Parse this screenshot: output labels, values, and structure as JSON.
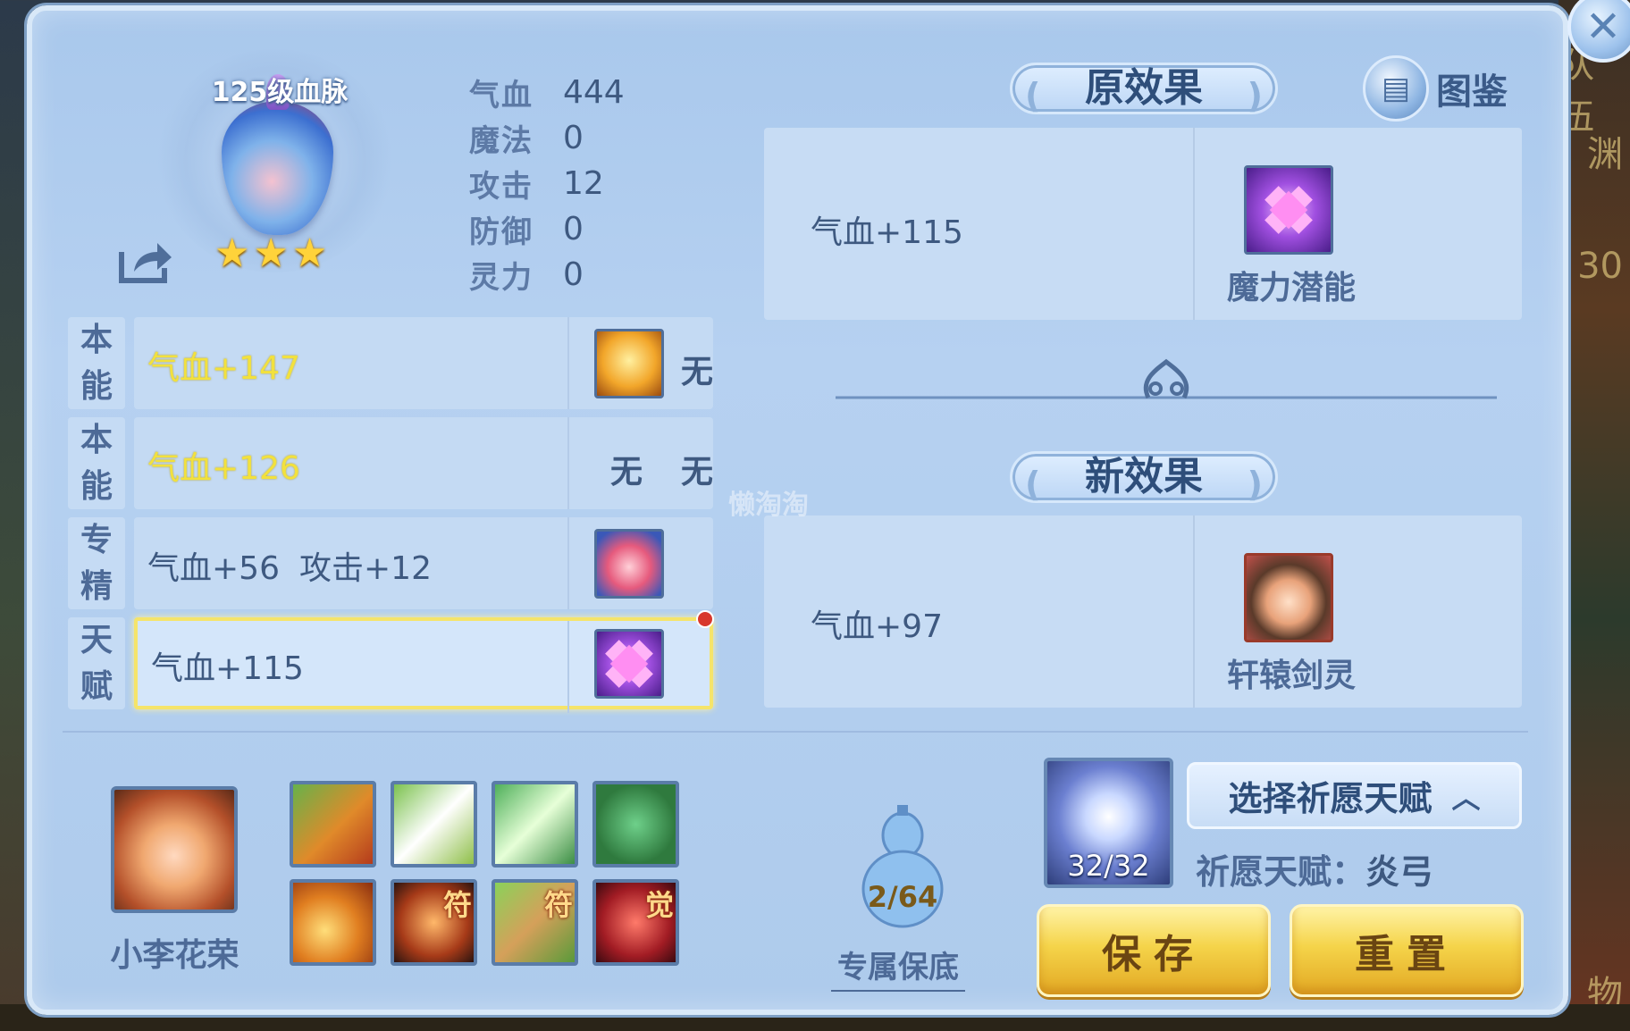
{
  "background": {
    "right_texts": [
      "队伍",
      "渊",
      "30",
      "物"
    ]
  },
  "pet": {
    "bloodline_label": "125级血脉",
    "stars": 3
  },
  "stats": [
    {
      "name": "气血",
      "value": "444"
    },
    {
      "name": "魔法",
      "value": "0"
    },
    {
      "name": "攻击",
      "value": "12"
    },
    {
      "name": "防御",
      "value": "0"
    },
    {
      "name": "灵力",
      "value": "0"
    }
  ],
  "ability_rows": [
    {
      "tag_top": "本",
      "tag_bottom": "能",
      "effect": "气血+147",
      "effect2": "",
      "slot1": "",
      "slot2": "无",
      "icon": "golden-orb-icon"
    },
    {
      "tag_top": "本",
      "tag_bottom": "能",
      "effect": "气血+126",
      "effect2": "",
      "slot1": "无",
      "slot2": "无",
      "icon": ""
    },
    {
      "tag_top": "专",
      "tag_bottom": "精",
      "effect": "气血+56",
      "effect2": "攻击+12",
      "slot1": "",
      "slot2": "",
      "icon": "pet-skill-icon"
    },
    {
      "tag_top": "天",
      "tag_bottom": "赋",
      "effect": "气血+115",
      "effect2": "",
      "slot1": "",
      "slot2": "",
      "icon": "magic-potential-icon"
    }
  ],
  "original_effect": {
    "title": "原效果",
    "text": "气血+115",
    "talent_name": "魔力潜能"
  },
  "new_effect": {
    "title": "新效果",
    "text": "气血+97",
    "talent_name": "轩辕剑灵"
  },
  "handbook_label": "图鉴",
  "hero": {
    "name": "小李花荣"
  },
  "skills": [
    {
      "icon": "flaming-sword-skill-icon",
      "badge": ""
    },
    {
      "icon": "sword-skill-icon",
      "badge": ""
    },
    {
      "icon": "wing-skill-icon",
      "badge": ""
    },
    {
      "icon": "figure-skill-icon",
      "badge": ""
    },
    {
      "icon": "burst-skill-icon",
      "badge": ""
    },
    {
      "icon": "warrior-skill-icon",
      "badge": "符"
    },
    {
      "icon": "boot-skill-icon",
      "badge": "符"
    },
    {
      "icon": "awaken-skill-icon",
      "badge": "觉"
    }
  ],
  "gourd": {
    "count": "2/64",
    "label": "专属保底"
  },
  "crystal": {
    "count": "32/32"
  },
  "wish": {
    "select_label": "选择祈愿天赋",
    "current_label": "祈愿天赋",
    "current_value": "炎弓"
  },
  "buttons": {
    "save": "保存",
    "reset": "重置"
  },
  "watermark": "懒淘淘",
  "colors": {
    "panel": "#b6d1f1",
    "gold_button": "#f5d44a",
    "highlight": "#f5e46a",
    "yellow_text": "#f2e13d"
  }
}
